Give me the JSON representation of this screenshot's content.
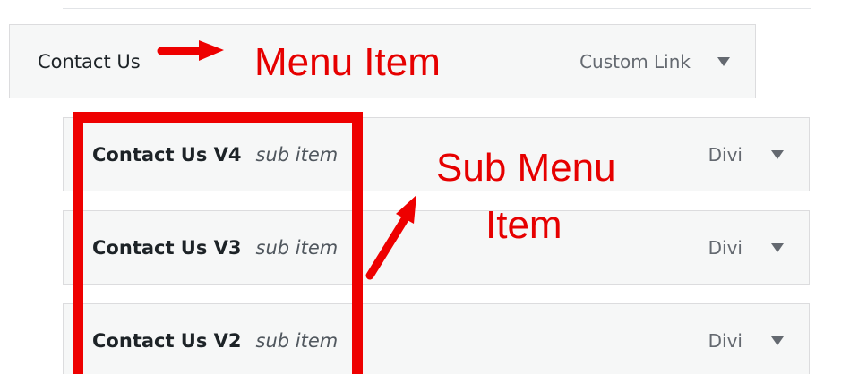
{
  "menu_items": [
    {
      "title": "Contact Us",
      "type": "Custom Link"
    }
  ],
  "sub_items": [
    {
      "title": "Contact Us V4",
      "label": "sub item",
      "type": "Divi"
    },
    {
      "title": "Contact Us V3",
      "label": "sub item",
      "type": "Divi"
    },
    {
      "title": "Contact Us V2",
      "label": "sub item",
      "type": "Divi"
    }
  ],
  "annotations": {
    "menu_item": "Menu Item",
    "sub_menu_line1": "Sub Menu",
    "sub_menu_line2": "Item",
    "color": "#e60000"
  },
  "icons": {
    "toggle": "triangle-down-icon"
  }
}
